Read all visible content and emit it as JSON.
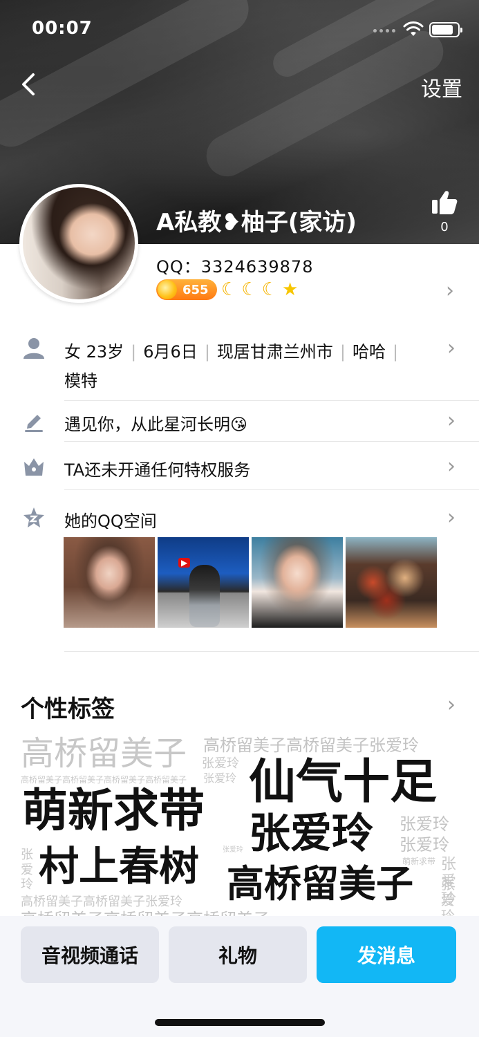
{
  "status_bar": {
    "time": "00:07"
  },
  "header": {
    "settings_label": "设置",
    "nickname": "A私教❥柚子(家访)",
    "like_count": "0"
  },
  "profile": {
    "qq_number": "QQ：3324639878",
    "level": "655",
    "badges": [
      "moon-icon",
      "moon-icon",
      "moon-icon",
      "star-icon"
    ]
  },
  "info": {
    "gender_age": "女 23岁",
    "birthday": "6月6日",
    "location": "现居甘肃兰州市",
    "hometown": "哈哈",
    "occupation": "模特",
    "signature": "遇见你，从此星河长明😘",
    "privilege": "TA还未开通任何特权服务",
    "qzone_label": "她的QQ空间"
  },
  "tags": {
    "title": "个性标签",
    "items": {
      "t1": "高桥留美子",
      "t2": "高桥留美子高桥留美子张爱玲",
      "t3": "张爱玲",
      "t4": "高桥留美子高桥留美子高桥留美子高桥留美子",
      "t5": "张爱玲",
      "t6": "仙气十足",
      "t7": "萌新求带",
      "t8": "张爱玲",
      "t9": "张爱玲",
      "t10": "张爱玲",
      "t11": "萌新求带",
      "t12": "张爱玲",
      "t13": "村上春树",
      "t14": "张爱玲",
      "t15": "高桥留美子",
      "t16": "张爱玲",
      "t17": "高桥留美子高桥留美子张爱玲",
      "t18": "张爱玲",
      "t19": "高桥留美子高桥留美子高桥留美子"
    }
  },
  "actions": {
    "call_label": "音视频通话",
    "gift_label": "礼物",
    "message_label": "发消息"
  }
}
